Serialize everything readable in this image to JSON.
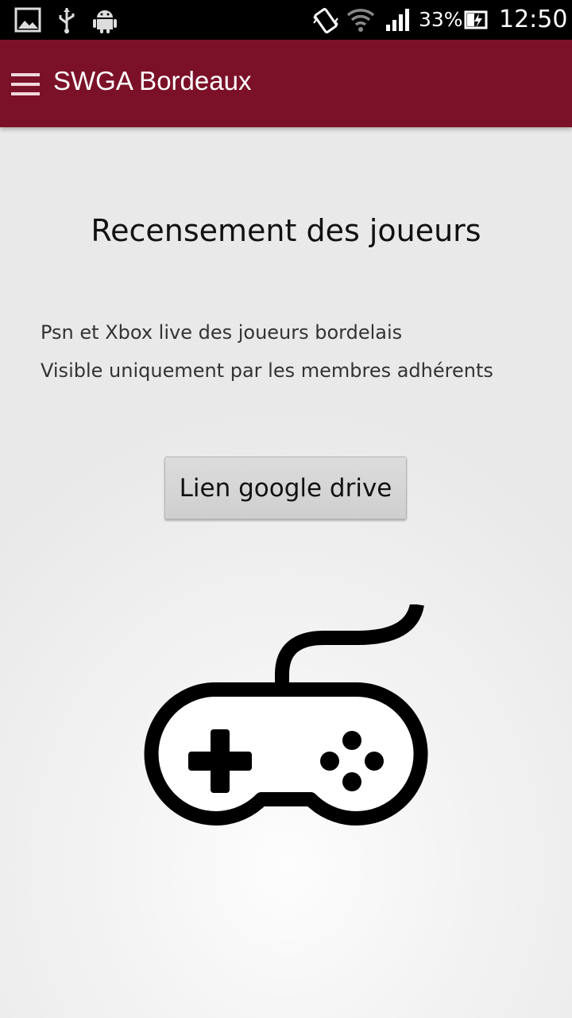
{
  "status_bar": {
    "icons": [
      "image-icon",
      "usb-icon",
      "android-icon",
      "vibrate-icon",
      "wifi-icon",
      "signal-icon",
      "battery-charging-icon"
    ],
    "battery_percent": "33%",
    "time": "12:50"
  },
  "app_bar": {
    "title": "SWGA Bordeaux",
    "menu_icon": "hamburger-menu-icon",
    "color": "#7b1128"
  },
  "content": {
    "heading": "Recensement des joueurs",
    "description_lines": [
      "Psn et Xbox live des joueurs bordelais",
      "Visible uniquement par les membres adhérents"
    ],
    "button_label": "Lien google drive",
    "illustration": "gamepad-icon"
  }
}
